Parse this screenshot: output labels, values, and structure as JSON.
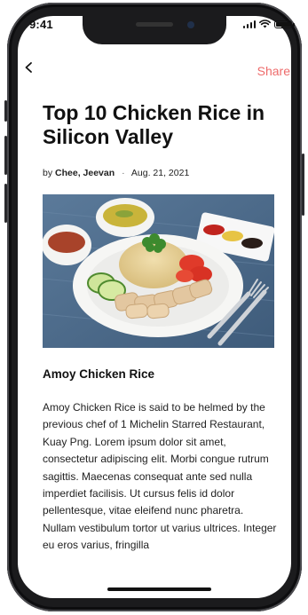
{
  "status_bar": {
    "time": "9:41"
  },
  "nav": {
    "share_label": "Share",
    "accent_color": "#ee6b6b"
  },
  "article": {
    "title": "Top 10 Chicken Rice in Silicon Valley",
    "byline": {
      "prefix": "by",
      "authors": "Chee, Jeevan",
      "separator": "·",
      "date": "Aug. 21, 2021"
    },
    "image": {
      "description_icon": "chicken-rice-photo"
    },
    "section_title": "Amoy Chicken Rice",
    "body": "Amoy Chicken Rice is said to be helmed by the previous chef of 1 Michelin Starred Restaurant, Kuay Png. Lorem ipsum dolor sit amet, consectetur adipiscing elit. Morbi congue rutrum sagittis. Maecenas consequat ante sed nulla imperdiet facilisis. Ut cursus felis id dolor pellentesque, vitae eleifend nunc pharetra. Nullam vestibulum tortor ut varius ultrices. Integer eu eros varius, fringilla"
  }
}
